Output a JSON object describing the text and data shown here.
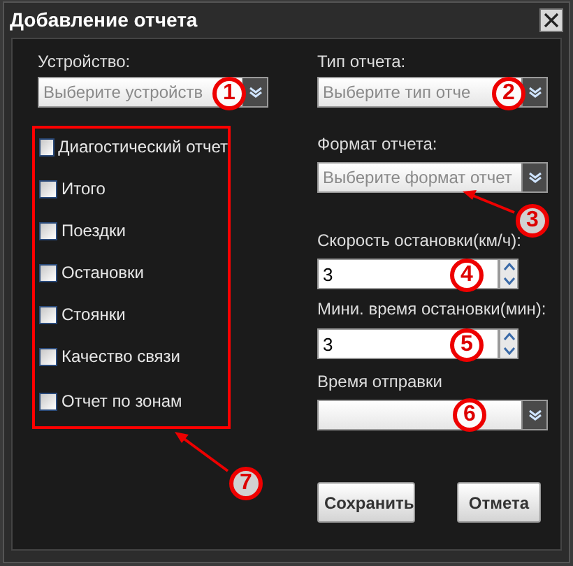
{
  "window": {
    "title": "Добавление отчета"
  },
  "device": {
    "label": "Устройство:",
    "placeholder": "Выберите устройств"
  },
  "report_type": {
    "label": "Тип отчета:",
    "placeholder": "Выберите тип отче"
  },
  "report_options": [
    {
      "label": "Диагостический отчет",
      "checked": false
    },
    {
      "label": "Итого",
      "checked": false
    },
    {
      "label": "Поездки",
      "checked": false
    },
    {
      "label": "Остановки",
      "checked": false
    },
    {
      "label": "Стоянки",
      "checked": false
    },
    {
      "label": "Качество связи",
      "checked": false
    },
    {
      "label": "Отчет по зонам",
      "checked": false
    }
  ],
  "report_format": {
    "label": "Формат отчета:",
    "placeholder": "Выберите формат отчет"
  },
  "stop_speed": {
    "label": "Скорость остановки(км/ч):",
    "value": "3"
  },
  "min_stop_time": {
    "label": "Мини. время остановки(мин):",
    "value": "3"
  },
  "send_time": {
    "label": "Время отправки"
  },
  "buttons": [
    "Сохранить",
    "Отмета"
  ],
  "annotations": [
    {
      "number": "1"
    },
    {
      "number": "2"
    },
    {
      "number": "3"
    },
    {
      "number": "4"
    },
    {
      "number": "5"
    },
    {
      "number": "6"
    },
    {
      "number": "7"
    }
  ]
}
